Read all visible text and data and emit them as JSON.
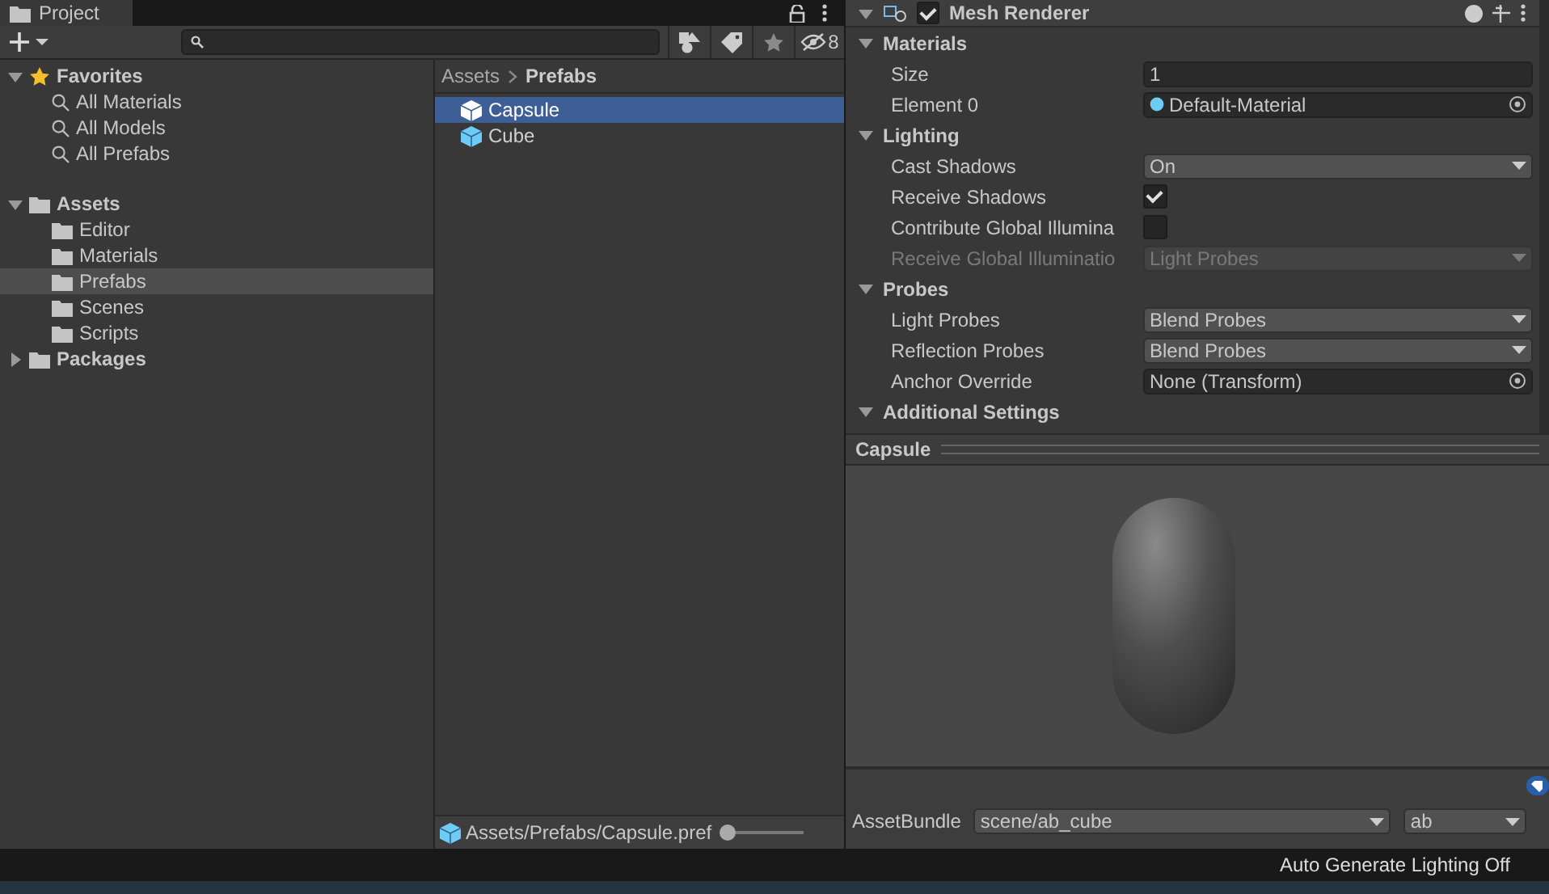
{
  "project_tab": {
    "title": "Project"
  },
  "toolbar": {
    "hidden_count": "8"
  },
  "favorites": {
    "label": "Favorites",
    "expanded": true,
    "items": [
      {
        "label": "All Materials"
      },
      {
        "label": "All Models"
      },
      {
        "label": "All Prefabs"
      }
    ]
  },
  "tree": [
    {
      "label": "Assets",
      "expanded": true,
      "selected": false,
      "children": [
        {
          "label": "Editor",
          "selected": false
        },
        {
          "label": "Materials",
          "selected": false
        },
        {
          "label": "Prefabs",
          "selected": true
        },
        {
          "label": "Scenes",
          "selected": false
        },
        {
          "label": "Scripts",
          "selected": false
        }
      ]
    },
    {
      "label": "Packages",
      "expanded": false,
      "selected": false
    }
  ],
  "breadcrumb": [
    "Assets",
    "Prefabs"
  ],
  "files": [
    {
      "label": "Capsule",
      "selected": true
    },
    {
      "label": "Cube",
      "selected": false
    }
  ],
  "path_bar": {
    "path": "Assets/Prefabs/Capsule.pref",
    "zoom": {
      "level": 0
    }
  },
  "inspector": {
    "component": {
      "title": "Mesh Renderer",
      "enabled": true
    },
    "rows": [
      {
        "kind": "section",
        "label": "Materials",
        "expanded": true
      },
      {
        "kind": "text",
        "label": "Size",
        "value": "1",
        "disabled": false
      },
      {
        "kind": "object",
        "label": "Element 0",
        "value": "Default-Material",
        "disabled": false
      },
      {
        "kind": "section",
        "label": "Lighting",
        "expanded": true
      },
      {
        "kind": "dropdown",
        "label": "Cast Shadows",
        "value": "On",
        "disabled": false
      },
      {
        "kind": "checkbox",
        "label": "Receive Shadows",
        "checked": true,
        "disabled": false
      },
      {
        "kind": "checkbox",
        "label": "Contribute Global Illumina",
        "checked": false,
        "disabled": false
      },
      {
        "kind": "dropdown",
        "label": "Receive Global Illuminatio",
        "value": "Light Probes",
        "disabled": true
      },
      {
        "kind": "section",
        "label": "Probes",
        "expanded": true
      },
      {
        "kind": "dropdown",
        "label": "Light Probes",
        "value": "Blend Probes",
        "disabled": false
      },
      {
        "kind": "dropdown",
        "label": "Reflection Probes",
        "value": "Blend Probes",
        "disabled": false
      },
      {
        "kind": "object",
        "label": "Anchor Override",
        "value": "None (Transform)",
        "disabled": false
      },
      {
        "kind": "section",
        "label": "Additional Settings",
        "expanded": true
      }
    ]
  },
  "preview": {
    "title": "Capsule"
  },
  "asset_bundle": {
    "label": "AssetBundle",
    "name": "scene/ab_cube",
    "variant": "ab"
  },
  "status_bar": {
    "text": "Auto Generate Lighting Off"
  }
}
